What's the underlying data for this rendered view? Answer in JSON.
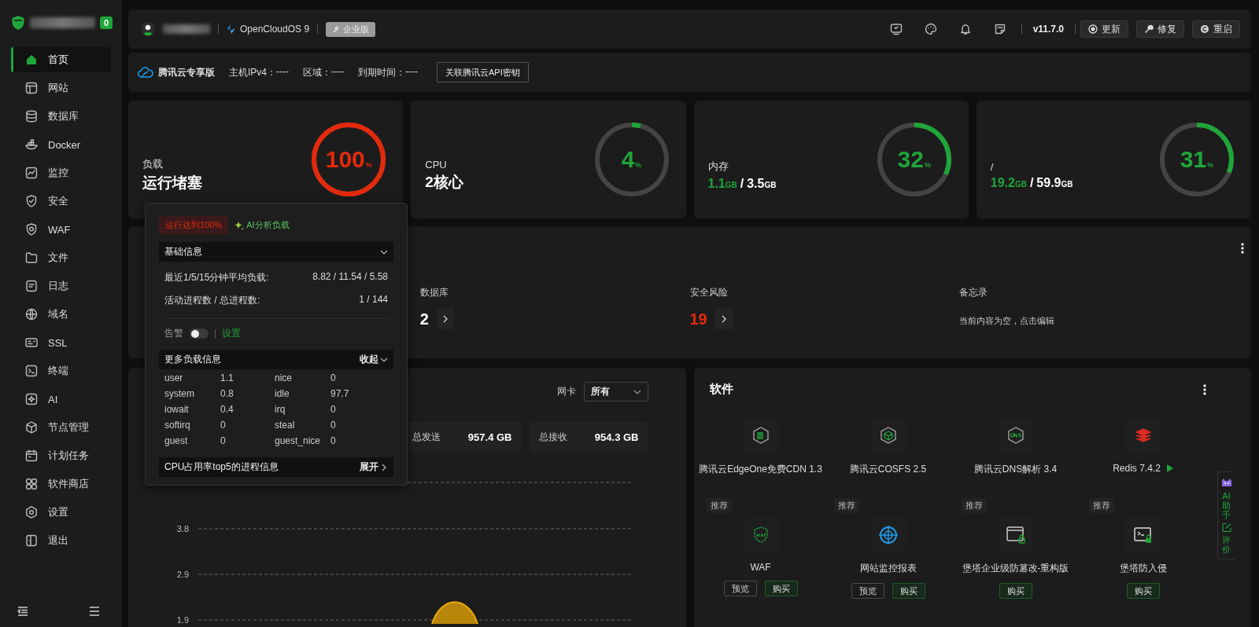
{
  "sidebar": {
    "badge": "0",
    "items": [
      {
        "label": "首页",
        "selected": true
      },
      {
        "label": "网站",
        "selected": false
      },
      {
        "label": "数据库",
        "selected": false
      },
      {
        "label": "Docker",
        "selected": false
      },
      {
        "label": "监控",
        "selected": false
      },
      {
        "label": "安全",
        "selected": false
      },
      {
        "label": "WAF",
        "selected": false
      },
      {
        "label": "文件",
        "selected": false
      },
      {
        "label": "日志",
        "selected": false
      },
      {
        "label": "域名",
        "selected": false
      },
      {
        "label": "SSL",
        "selected": false
      },
      {
        "label": "终端",
        "selected": false
      },
      {
        "label": "AI",
        "selected": false
      },
      {
        "label": "节点管理",
        "selected": false
      },
      {
        "label": "计划任务",
        "selected": false
      },
      {
        "label": "软件商店",
        "selected": false
      },
      {
        "label": "设置",
        "selected": false
      },
      {
        "label": "退出",
        "selected": false
      }
    ]
  },
  "topbar": {
    "os": "OpenCloudOS 9",
    "edition": "企业版",
    "version": "v11.7.0",
    "buttons": [
      "更新",
      "修复",
      "重启"
    ]
  },
  "cloud_bar": {
    "title": "腾讯云专享版",
    "fields": [
      {
        "label": "主机IPv4：",
        "value": "----"
      },
      {
        "label": "区域：",
        "value": "----"
      },
      {
        "label": "到期时间：",
        "value": "----"
      }
    ],
    "button": "关联腾讯云API密钥"
  },
  "metrics": [
    {
      "kind": "text",
      "label": "负载",
      "value": "运行堵塞",
      "reading": "100",
      "unit": "%",
      "level": 1,
      "color": "#e5290c"
    },
    {
      "kind": "text",
      "label": "CPU",
      "value": "2核心",
      "reading": "4",
      "unit": "%",
      "level": 0.04,
      "color": "#20a53a"
    },
    {
      "kind": "usage",
      "label": "内存",
      "used": "1.1",
      "used_unit": "GB",
      "separator": "/",
      "total": "3.5",
      "total_unit": "GB",
      "reading": "32",
      "unit": "%",
      "level": 0.32,
      "color": "#20a53a"
    },
    {
      "kind": "usage",
      "label": "/",
      "used": "19.2",
      "used_unit": "GB",
      "separator": "/",
      "total": "59.9",
      "total_unit": "GB",
      "reading": "31",
      "unit": "%",
      "level": 0.31,
      "color": "#20a53a"
    }
  ],
  "overview": {
    "items": [
      {
        "kind": "count",
        "label": "数据库",
        "value": "2",
        "alert": false
      },
      {
        "kind": "count",
        "label": "安全风险",
        "value": "19",
        "alert": true
      },
      {
        "kind": "memo",
        "label": "备忘录",
        "text": "当前内容为空，点击编辑"
      }
    ]
  },
  "traffic": {
    "nic_label": "网卡",
    "nic_value": "所有",
    "totals": [
      {
        "label": "总发送",
        "value": "957.4 GB"
      },
      {
        "label": "总接收",
        "value": "954.3 GB"
      }
    ],
    "chart": {
      "y_labels": [
        "3.8",
        "2.9",
        "1.9"
      ]
    }
  },
  "software": {
    "title": "软件",
    "items": [
      {
        "kind": "installed",
        "name": "腾讯云EdgeOne免费CDN 1.3",
        "running": false
      },
      {
        "kind": "installed",
        "name": "腾讯云COSFS 2.5",
        "running": false
      },
      {
        "kind": "installed",
        "name": "腾讯云DNS解析 3.4",
        "running": false
      },
      {
        "kind": "installed",
        "name": "Redis 7.4.2",
        "running": true
      },
      {
        "kind": "recommended",
        "tag": "推荐",
        "name": "WAF",
        "buttons": [
          {
            "kind": "preview",
            "label": "预览"
          },
          {
            "kind": "buy",
            "label": "购买"
          }
        ]
      },
      {
        "kind": "recommended",
        "tag": "推荐",
        "name": "网站监控报表",
        "buttons": [
          {
            "kind": "preview",
            "label": "预览"
          },
          {
            "kind": "buy",
            "label": "购买"
          }
        ]
      },
      {
        "kind": "recommended",
        "tag": "推荐",
        "name": "堡塔企业级防篡改-重构版",
        "buttons": [
          {
            "kind": "buy",
            "label": "购买"
          }
        ]
      },
      {
        "kind": "recommended",
        "tag": "推荐",
        "name": "堡塔防入侵",
        "buttons": [
          {
            "kind": "buy",
            "label": "购买"
          }
        ]
      }
    ]
  },
  "load_popup": {
    "status_badge": "运行达到100%",
    "ai_link": "AI分析负载",
    "basic": {
      "title": "基础信息",
      "expanded": true,
      "rows": [
        {
          "label": "最近1/5/15分钟平均负载:",
          "value": "8.82 / 11.54 / 5.58"
        },
        {
          "label": "活动进程数 / 总进程数:",
          "value": "1 / 144"
        }
      ]
    },
    "alarm": {
      "label": "告警",
      "on": false,
      "link": "设置"
    },
    "more": {
      "title": "更多负载信息",
      "toggle": "收起",
      "expanded": true,
      "stats": [
        {
          "name": "user",
          "value": "1.1"
        },
        {
          "name": "nice",
          "value": "0"
        },
        {
          "name": "system",
          "value": "0.8"
        },
        {
          "name": "idle",
          "value": "97.7"
        },
        {
          "name": "iowait",
          "value": "0.4"
        },
        {
          "name": "irq",
          "value": "0"
        },
        {
          "name": "softirq",
          "value": "0"
        },
        {
          "name": "steal",
          "value": "0"
        },
        {
          "name": "guest",
          "value": "0"
        },
        {
          "name": "guest_nice",
          "value": "0"
        }
      ]
    },
    "top5": {
      "title": "CPU占用率top5的进程信息",
      "toggle": "展开",
      "expanded": false
    }
  },
  "float_panel": {
    "items": [
      "AI助手",
      "评价"
    ]
  }
}
